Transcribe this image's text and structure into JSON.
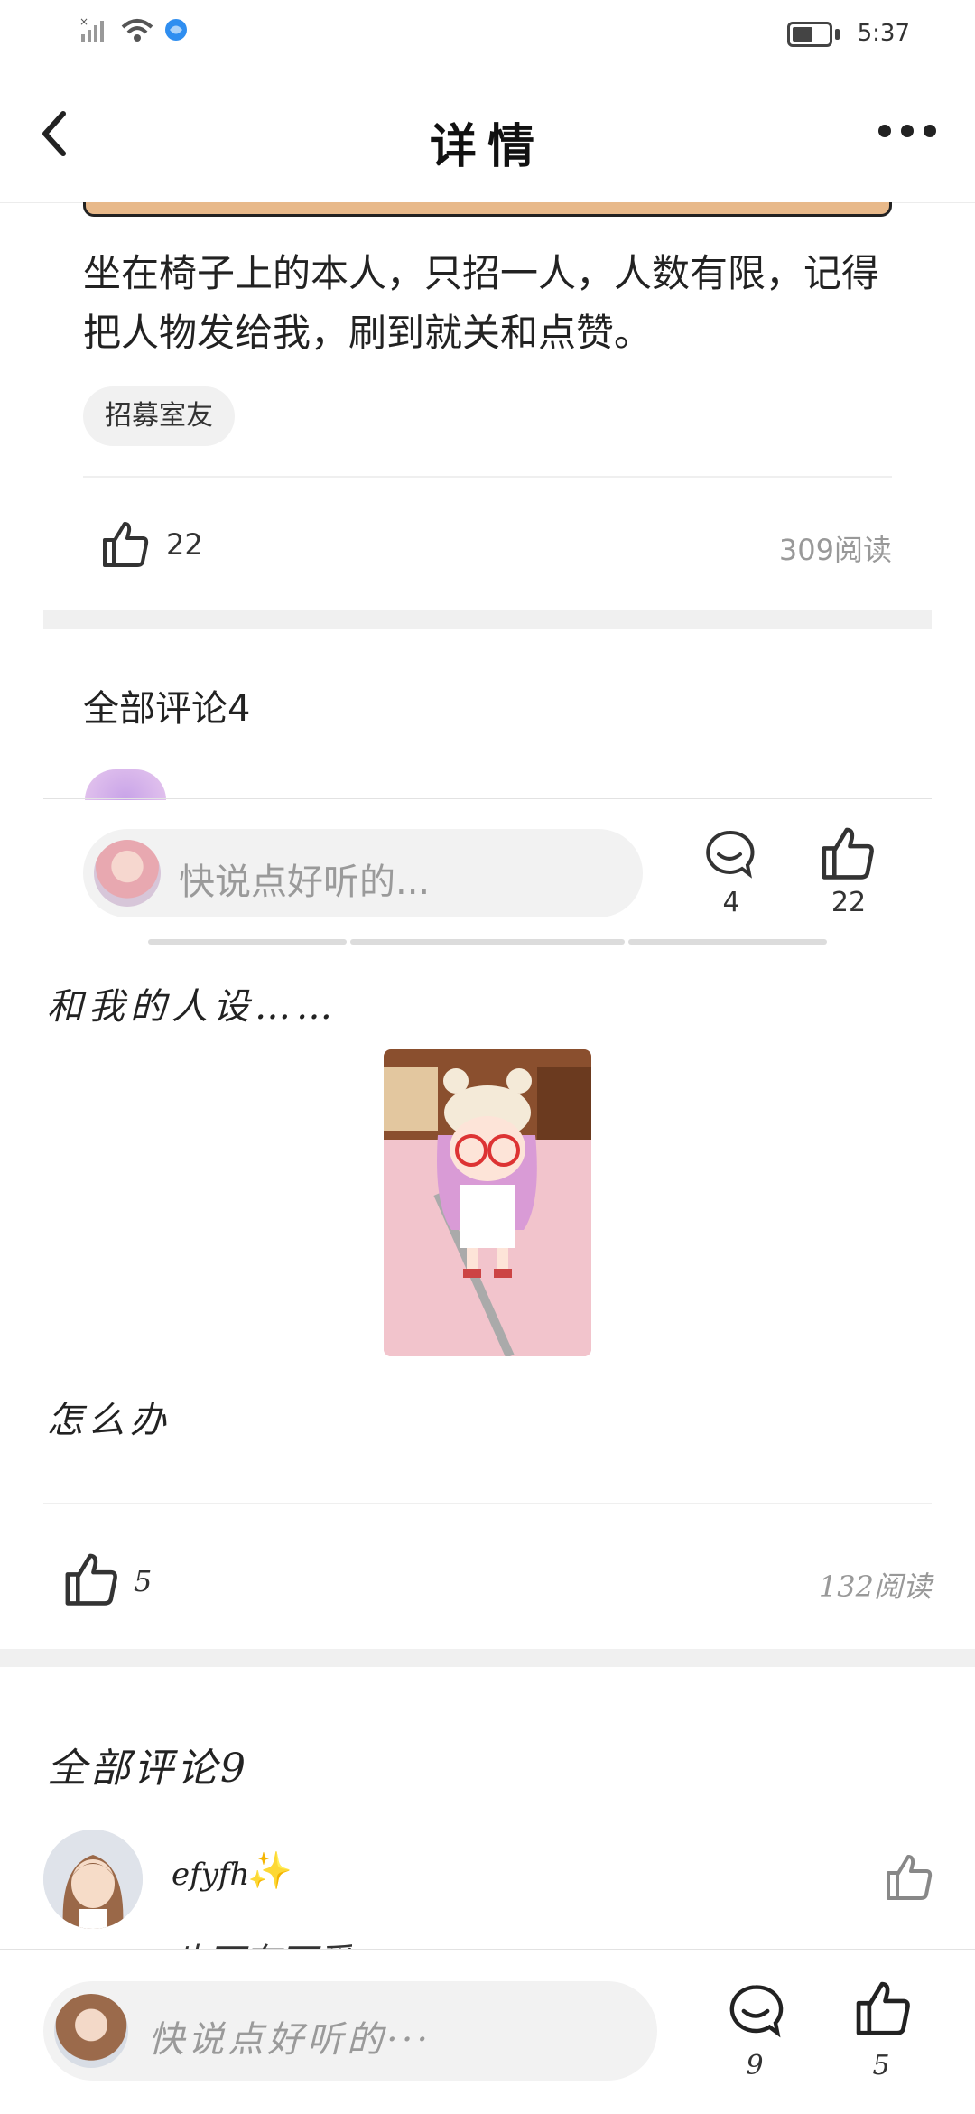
{
  "status_bar": {
    "time": "5:37"
  },
  "header": {
    "title": "详情"
  },
  "post": {
    "text": "坐在椅子上的本人，只招一人，人数有限，记得把人物发给我，刷到就关和点赞。",
    "tag": "招募室友",
    "likes": "22",
    "views": "309阅读"
  },
  "comments_section": {
    "title": "全部评论4"
  },
  "comment_bar": {
    "placeholder": "快说点好听的...",
    "comment_count": "4",
    "like_count": "22"
  },
  "post2": {
    "text": "和我的人设……",
    "text2": "怎么办",
    "likes": "5",
    "views": "132阅读"
  },
  "comments_section2": {
    "title": "全部评论9"
  },
  "comment": {
    "user": "efyfh",
    "sparkle": "✨",
    "text": "也可有可爱"
  },
  "comment_bar2": {
    "placeholder": "快说点好听的···",
    "comment_count": "9",
    "like_count": "5"
  },
  "colors": {
    "muted_text": "#999999",
    "gap_bar": "#f0f0f0",
    "input_bg": "#f2f2f2"
  },
  "icons": [
    "back-arrow",
    "more-dots",
    "thumbs-up",
    "comment-bubble",
    "sparkle"
  ]
}
